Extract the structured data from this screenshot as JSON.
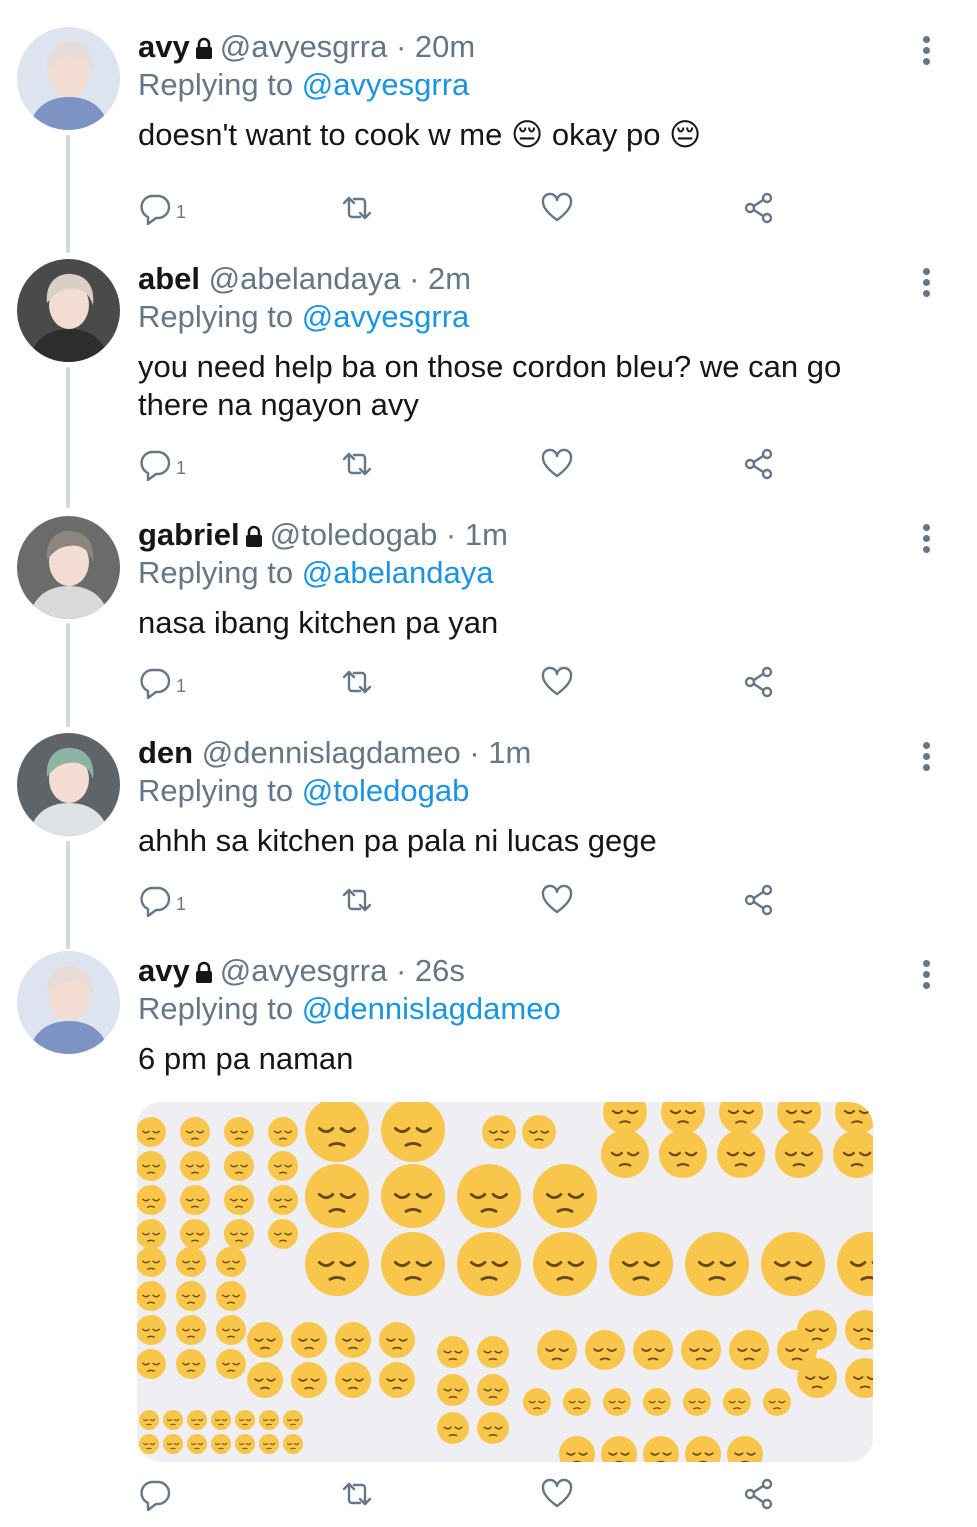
{
  "tweets": [
    {
      "name": "avy",
      "locked": true,
      "handle": "@avyesgrra",
      "time": "20m",
      "replying_prefix": "Replying to ",
      "replying_to": "@avyesgrra",
      "text": "doesn't want to cook w me 😔 okay po 😔",
      "reply_count": "1",
      "avatar": {
        "bg": "#dde4ef",
        "hair": "#e7dcd7",
        "shirt": "#7d93c4"
      }
    },
    {
      "name": "abel",
      "locked": false,
      "handle": "@abelandaya",
      "time": "2m",
      "replying_prefix": "Replying to ",
      "replying_to": "@avyesgrra",
      "text": "you need help ba on those cordon bleu? we can go there na ngayon avy",
      "reply_count": "1",
      "avatar": {
        "bg": "#4a4a4a",
        "hair": "#d9cfc6",
        "shirt": "#2c2f2b"
      }
    },
    {
      "name": "gabriel",
      "locked": true,
      "handle": "@toledogab",
      "time": "1m",
      "replying_prefix": "Replying to ",
      "replying_to": "@abelandaya",
      "text": "nasa ibang kitchen pa yan",
      "reply_count": "1",
      "avatar": {
        "bg": "#6b6b6b",
        "hair": "#8d8680",
        "shirt": "#d9d9d9"
      }
    },
    {
      "name": "den",
      "locked": false,
      "handle": "@dennislagdameo",
      "time": "1m",
      "replying_prefix": "Replying to ",
      "replying_to": "@toledogab",
      "text": "ahhh sa kitchen pa pala ni lucas gege",
      "reply_count": "1",
      "avatar": {
        "bg": "#5f6468",
        "hair": "#8fb3a2",
        "shirt": "#dfe2e4"
      }
    },
    {
      "name": "avy",
      "locked": true,
      "handle": "@avyesgrra",
      "time": "26s",
      "replying_prefix": "Replying to ",
      "replying_to": "@dennislagdameo",
      "text": "6 pm pa naman",
      "reply_count": "",
      "avatar": {
        "bg": "#dde4ef",
        "hair": "#e7dcd7",
        "shirt": "#7d93c4"
      }
    }
  ],
  "icons": {
    "more": "more-vertical-icon",
    "lock": "lock-icon",
    "reply": "reply-icon",
    "retweet": "retweet-icon",
    "like": "heart-icon",
    "share": "share-icon"
  },
  "media": {
    "description_icon": "pensive-face-emoji-collage",
    "emoji_color": "#f7c64a",
    "background": "#eeeef3"
  },
  "colors": {
    "text": "#14171a",
    "secondary": "#657786",
    "link": "#1b95e0",
    "thread_line": "#cfd9de"
  }
}
